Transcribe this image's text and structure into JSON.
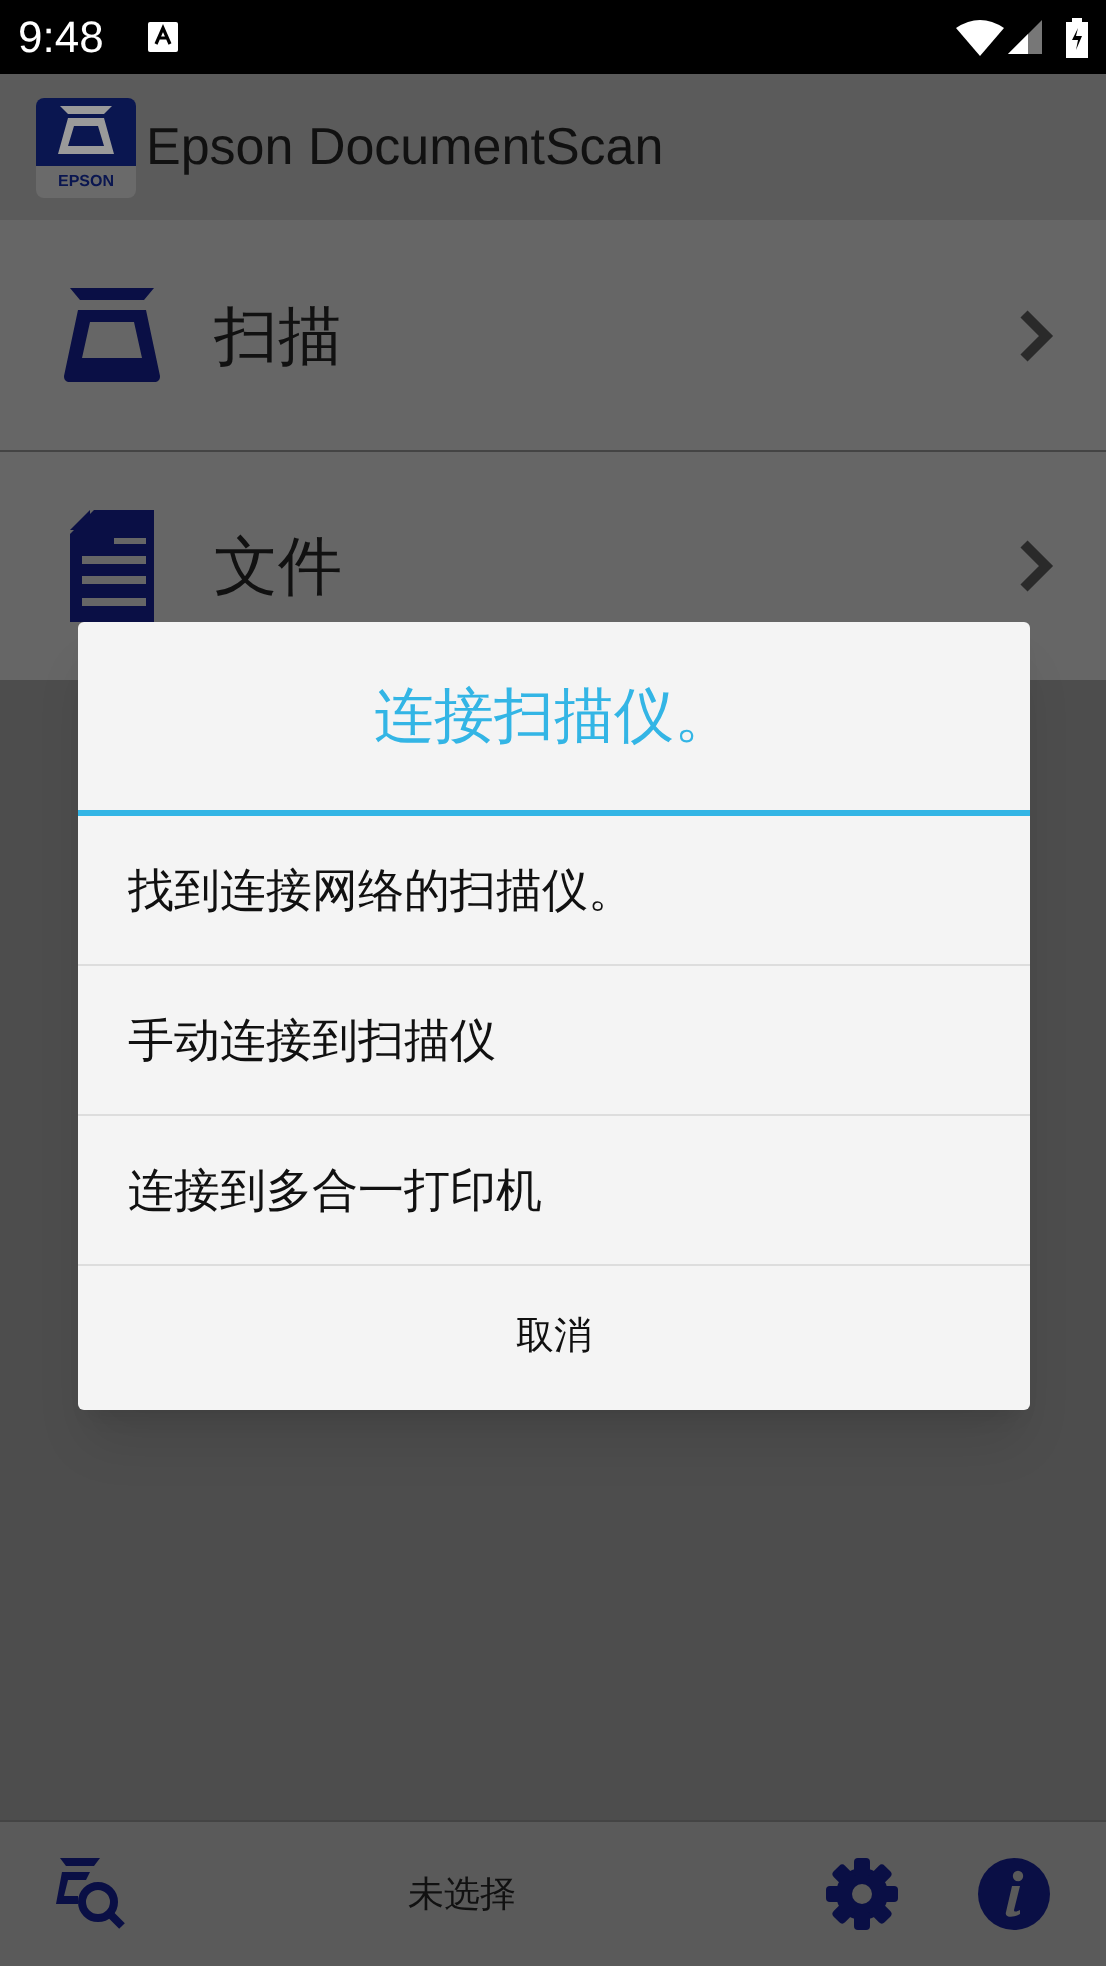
{
  "status_bar": {
    "time": "9:48"
  },
  "app_bar": {
    "title": "Epson DocumentScan",
    "logo_text": "EPSON"
  },
  "menu": [
    {
      "kind": "scan",
      "label": "扫描"
    },
    {
      "kind": "document",
      "label": "文件"
    }
  ],
  "dialog": {
    "title": "连接扫描仪。",
    "options": [
      "找到连接网络的扫描仪。",
      "手动连接到扫描仪",
      "连接到多合一打印机"
    ],
    "cancel": "取消"
  },
  "bottom_bar": {
    "status": "未选择"
  }
}
